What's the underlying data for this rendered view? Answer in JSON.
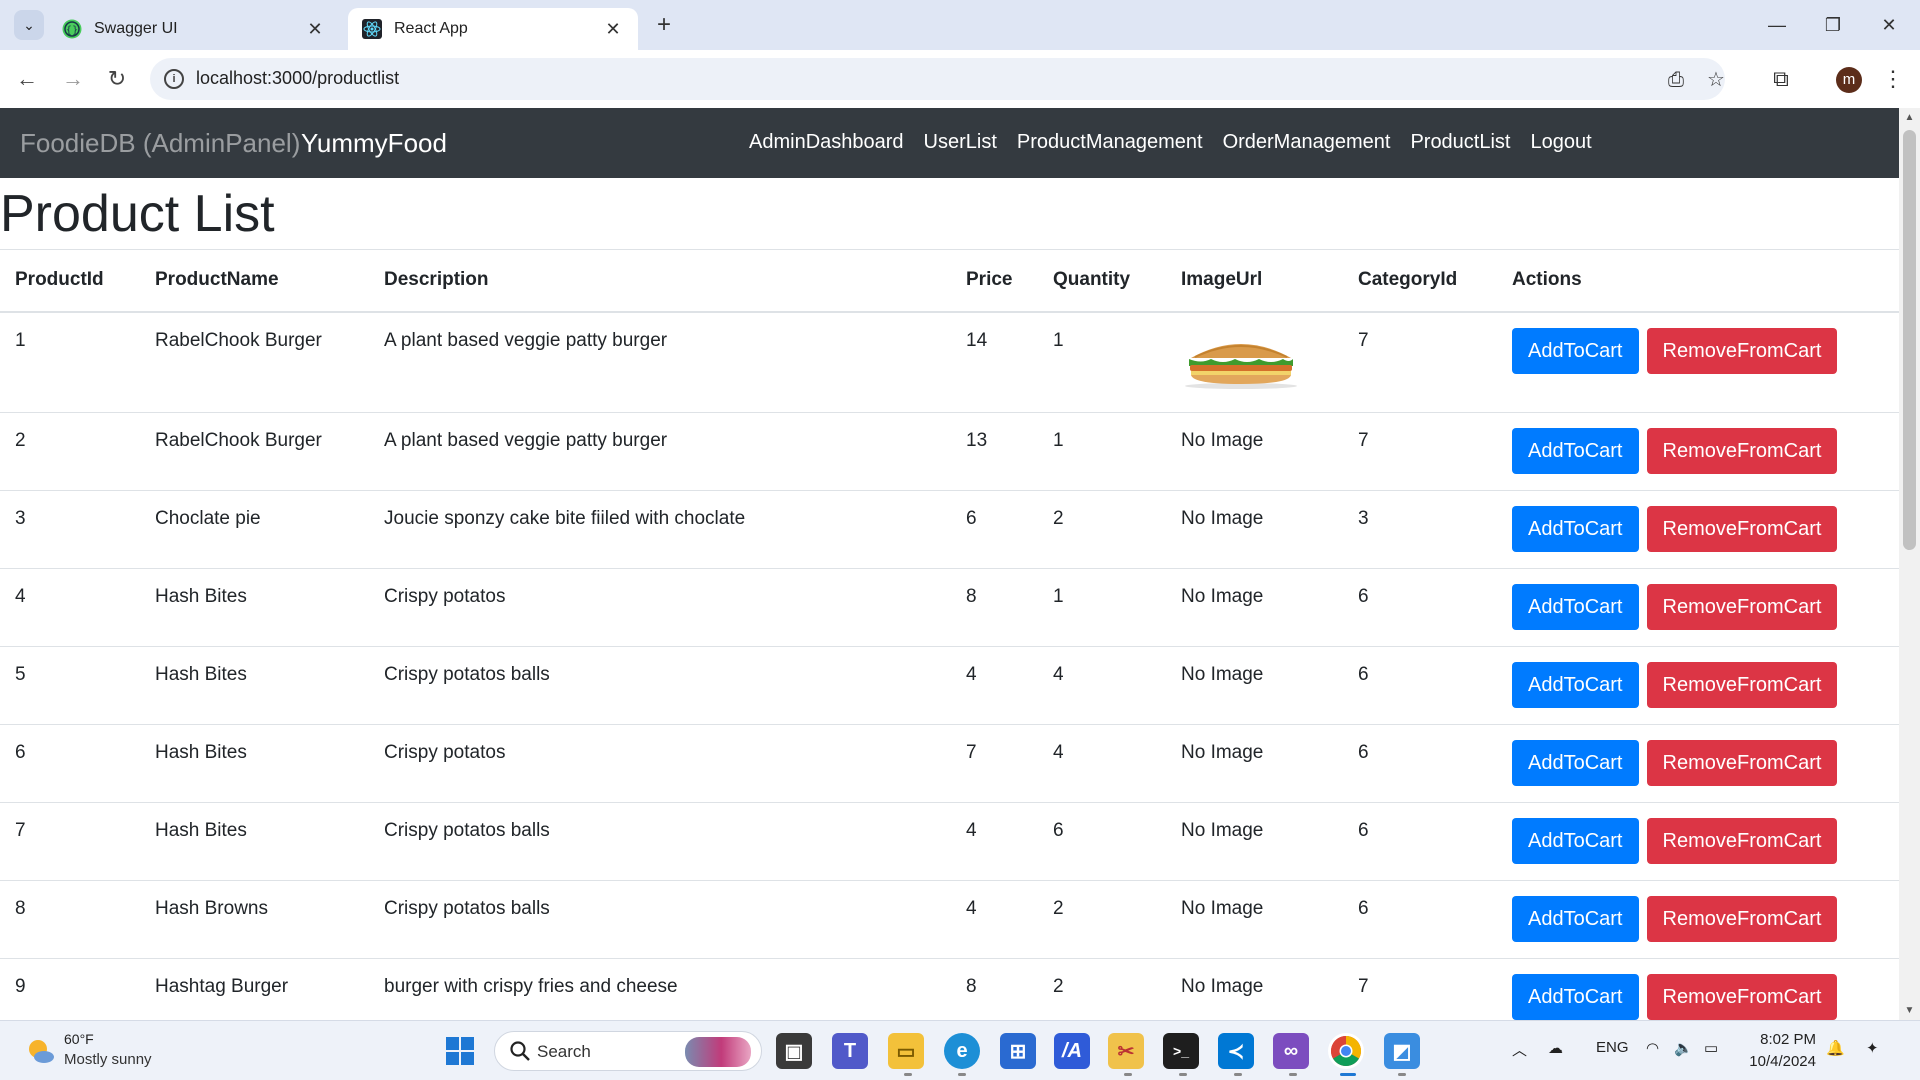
{
  "browser": {
    "tabs": [
      {
        "title": "Swagger UI",
        "active": false,
        "favicon": "swagger-icon"
      },
      {
        "title": "React App",
        "active": true,
        "favicon": "react-icon"
      }
    ],
    "url": "localhost:3000/productlist",
    "profile_initial": "m"
  },
  "navbar": {
    "brand_admin": "FoodieDB (AdminPanel)",
    "brand_app": "YummyFood",
    "links": [
      "AdminDashboard",
      "UserList",
      "ProductManagement",
      "OrderManagement",
      "ProductList",
      "Logout"
    ]
  },
  "page": {
    "title": "Product List"
  },
  "table": {
    "headers": [
      "ProductId",
      "ProductName",
      "Description",
      "Price",
      "Quantity",
      "ImageUrl",
      "CategoryId",
      "Actions"
    ],
    "add_label": "AddToCart",
    "remove_label": "RemoveFromCart",
    "no_image_label": "No Image",
    "rows": [
      {
        "id": "1",
        "name": "RabelChook Burger",
        "description": "A plant based veggie patty burger",
        "price": "14",
        "quantity": "1",
        "image": "burger",
        "category": "7"
      },
      {
        "id": "2",
        "name": "RabelChook Burger",
        "description": "A plant based veggie patty burger",
        "price": "13",
        "quantity": "1",
        "image": "No Image",
        "category": "7"
      },
      {
        "id": "3",
        "name": "Choclate pie",
        "description": "Joucie sponzy cake bite fiiled with choclate",
        "price": "6",
        "quantity": "2",
        "image": "No Image",
        "category": "3"
      },
      {
        "id": "4",
        "name": "Hash Bites",
        "description": "Crispy potatos",
        "price": "8",
        "quantity": "1",
        "image": "No Image",
        "category": "6"
      },
      {
        "id": "5",
        "name": "Hash Bites",
        "description": "Crispy potatos balls",
        "price": "4",
        "quantity": "4",
        "image": "No Image",
        "category": "6"
      },
      {
        "id": "6",
        "name": "Hash Bites",
        "description": "Crispy potatos",
        "price": "7",
        "quantity": "4",
        "image": "No Image",
        "category": "6"
      },
      {
        "id": "7",
        "name": "Hash Bites",
        "description": "Crispy potatos balls",
        "price": "4",
        "quantity": "6",
        "image": "No Image",
        "category": "6"
      },
      {
        "id": "8",
        "name": "Hash Browns",
        "description": "Crispy potatos balls",
        "price": "4",
        "quantity": "2",
        "image": "No Image",
        "category": "6"
      },
      {
        "id": "9",
        "name": "Hashtag Burger",
        "description": "burger with crispy fries and cheese",
        "price": "8",
        "quantity": "2",
        "image": "No Image",
        "category": "7"
      }
    ]
  },
  "taskbar": {
    "weather_temp": "60°F",
    "weather_desc": "Mostly sunny",
    "search_label": "Search",
    "language": "ENG",
    "time": "8:02 PM",
    "date": "10/4/2024"
  },
  "colors": {
    "navbar_bg": "#343a40",
    "add_button": "#007bff",
    "remove_button": "#dc3545"
  }
}
